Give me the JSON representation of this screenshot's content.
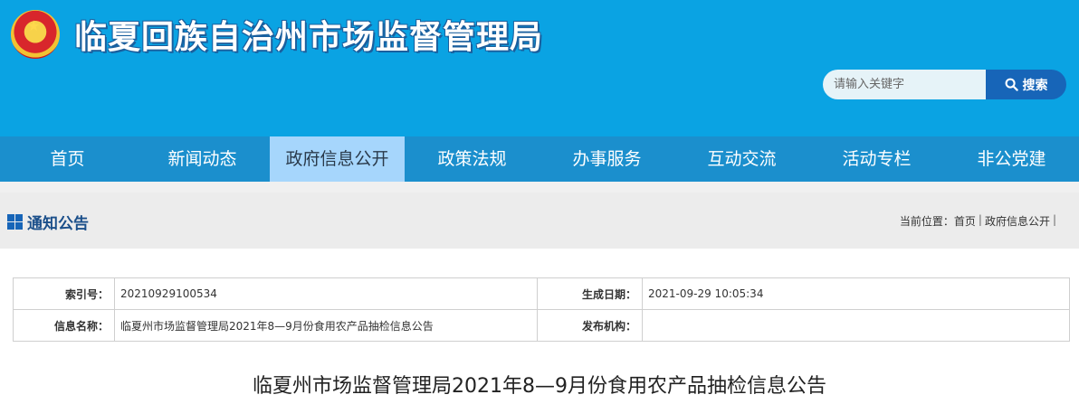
{
  "header": {
    "site_title": "临夏回族自治州市场监督管理局",
    "search_placeholder": "请输入关键字",
    "search_button": "搜索"
  },
  "nav": {
    "items": [
      {
        "label": "首页",
        "active": false
      },
      {
        "label": "新闻动态",
        "active": false
      },
      {
        "label": "政府信息公开",
        "active": true
      },
      {
        "label": "政策法规",
        "active": false
      },
      {
        "label": "办事服务",
        "active": false
      },
      {
        "label": "互动交流",
        "active": false
      },
      {
        "label": "活动专栏",
        "active": false
      },
      {
        "label": "非公党建",
        "active": false
      }
    ]
  },
  "section": {
    "title": "通知公告",
    "breadcrumb_prefix": "当前位置：",
    "breadcrumb": [
      "首页",
      "政府信息公开"
    ]
  },
  "info": {
    "index_label": "索引号：",
    "index_value": "20210929100534",
    "date_label": "生成日期：",
    "date_value": "2021-09-29 10:05:34",
    "name_label": "信息名称：",
    "name_value": "临夏州市场监督管理局2021年8—9月份食用农产品抽检信息公告",
    "publisher_label": "发布机构：",
    "publisher_value": ""
  },
  "article": {
    "title": "临夏州市场监督管理局2021年8—9月份食用农产品抽检信息公告"
  },
  "colors": {
    "header_bg": "#0aa3e3",
    "nav_bg": "#1b8fcd",
    "nav_active_bg": "#a6d6fc",
    "search_button_bg": "#1765b8"
  }
}
